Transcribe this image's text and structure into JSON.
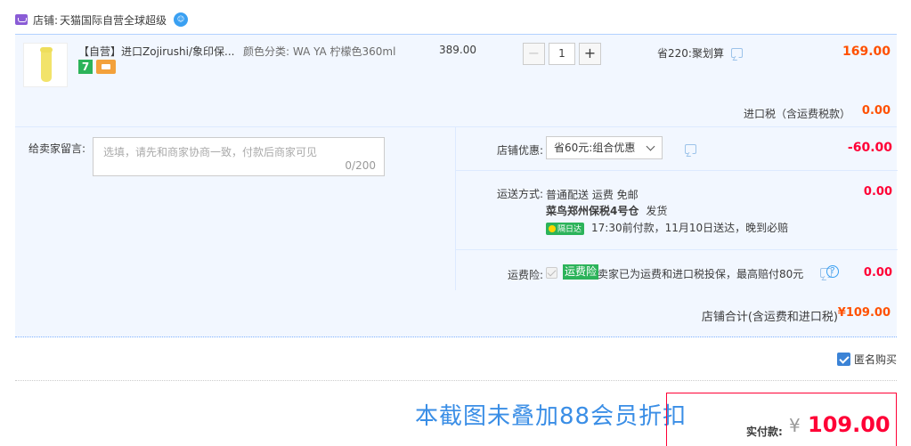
{
  "store": {
    "label": "店铺:",
    "name": "天猫国际自营全球超级",
    "wangwang_glyph": "☺"
  },
  "item": {
    "title": "【自营】进口Zojirushi/象印保...",
    "badge_7": "7",
    "spec": "颜色分类:  WA YA 柠檬色360ml",
    "unit_price": "389.00",
    "quantity": "1",
    "qty_minus": "−",
    "qty_plus": "+",
    "promo": "省220:聚划算",
    "subtotal": "169.00"
  },
  "tax": {
    "label": "进口税（含运费税款）",
    "value": "0.00"
  },
  "memo": {
    "label": "给卖家留言:",
    "placeholder": "选填，请先和商家协商一致，付款后商家可见",
    "counter": "0/200"
  },
  "coupon": {
    "label": "店铺优惠:",
    "selected": "省60元:组合优惠",
    "value": "-60.00"
  },
  "shipping": {
    "label": "运送方式:",
    "method": "普通配送 运费 免邮",
    "warehouse": "菜鸟郑州保税4号仓",
    "dispatch": "发货",
    "badge": "隔日达",
    "eta": "17:30前付款，11月10日送达，晚到必赔",
    "value": "0.00"
  },
  "insurance": {
    "label": "运费险:",
    "tag": "运费险",
    "text": "卖家已为运费和进口税投保，最高赔付80元",
    "help": "?",
    "value": "0.00"
  },
  "store_total": {
    "label": "店铺合计(含运费和进口税)",
    "value": "¥109.00"
  },
  "anonymous": {
    "label": "匿名购买",
    "checked": true
  },
  "overlay_note": "本截图未叠加88会员折扣",
  "payment": {
    "label": "实付款:",
    "currency": "¥",
    "value": "109.00"
  },
  "colors": {
    "price_orange": "#ff5000",
    "price_red": "#ff0036",
    "block_bg": "#f2f7ff",
    "tag_green": "#2cb35a",
    "note_blue": "#3a8ee6"
  }
}
